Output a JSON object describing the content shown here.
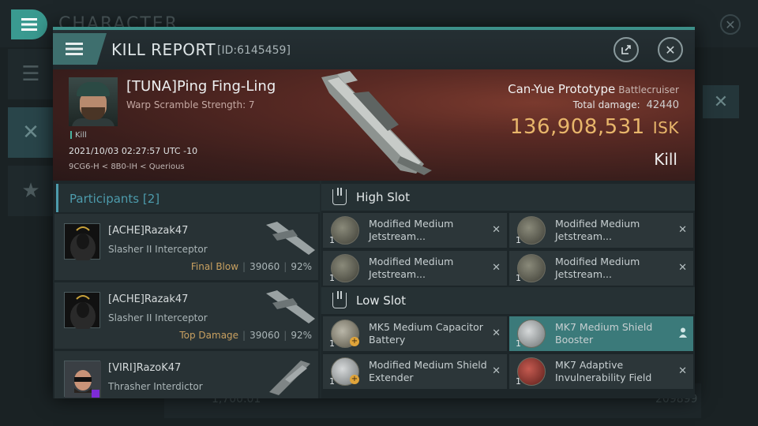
{
  "background": {
    "title": "CHARACTER",
    "bottom_value": "1,700.01",
    "bottom_right_value": "209899"
  },
  "modal": {
    "title": "KILL REPORT",
    "id": "[ID:6145459]",
    "victim": {
      "name": "[TUNA]Ping Fing-Ling",
      "warp": "Warp Scramble Strength: 7",
      "tag": "Kill",
      "datetime": "2021/10/03 02:27:57 UTC -10",
      "location": "9CG6-H < 8B0-IH < Querious"
    },
    "ship": {
      "name": "Can-Yue Prototype",
      "class": "Battlecruiser",
      "damage_label": "Total damage:",
      "damage": "42440",
      "isk_value": "136,908,531",
      "isk_unit": "ISK",
      "result": "Kill"
    },
    "participants": {
      "header": "Participants [2]",
      "rows": [
        {
          "name": "[ACHE]Razak47",
          "ship": "Slasher II Interceptor",
          "label": "Final Blow",
          "damage": "39060",
          "pct": "92%"
        },
        {
          "name": "[ACHE]Razak47",
          "ship": "Slasher II Interceptor",
          "label": "Top Damage",
          "damage": "39060",
          "pct": "92%"
        },
        {
          "name": "[VIRI]RazoK47",
          "ship": "Thrasher Interdictor",
          "label": "",
          "damage": "",
          "pct": ""
        }
      ]
    },
    "high_slot": {
      "title": "High Slot",
      "items": [
        {
          "qty": "1",
          "name": "Modified Medium Jetstream..."
        },
        {
          "qty": "1",
          "name": "Modified Medium Jetstream..."
        },
        {
          "qty": "1",
          "name": "Modified Medium Jetstream..."
        },
        {
          "qty": "1",
          "name": "Modified Medium Jetstream..."
        }
      ]
    },
    "low_slot": {
      "title": "Low Slot",
      "items": [
        {
          "qty": "1",
          "name": "MK5 Medium Capacitor Battery"
        },
        {
          "qty": "1",
          "name": "MK7 Medium Shield Booster"
        },
        {
          "qty": "1",
          "name": "Modified Medium Shield Extender"
        },
        {
          "qty": "1",
          "name": "MK7 Adaptive Invulnerability Field"
        }
      ]
    }
  }
}
